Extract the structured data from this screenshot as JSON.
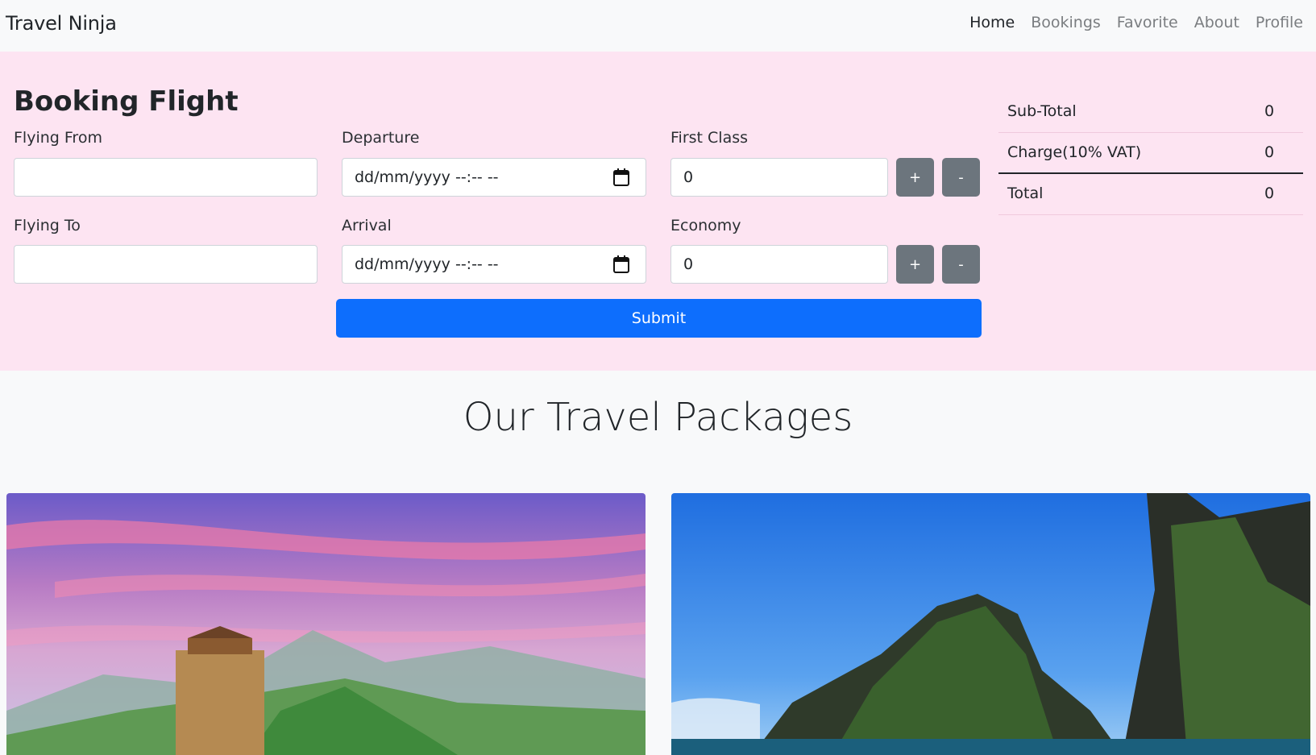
{
  "navbar": {
    "brand": "Travel Ninja",
    "links": [
      "Home",
      "Bookings",
      "Favorite",
      "About",
      "Profile"
    ],
    "active": "Home"
  },
  "booking": {
    "title": "Booking Flight",
    "flying_from_label": "Flying From",
    "flying_from_value": "",
    "flying_to_label": "Flying To",
    "flying_to_value": "",
    "departure_label": "Departure",
    "departure_placeholder": "dd/mm/yyyy --:-- --",
    "arrival_label": "Arrival",
    "arrival_placeholder": "dd/mm/yyyy --:-- --",
    "first_class_label": "First Class",
    "first_class_value": "0",
    "economy_label": "Economy",
    "economy_value": "0",
    "plus_label": "+",
    "minus_label": "-",
    "submit_label": "Submit"
  },
  "summary": {
    "subtotal_label": "Sub-Total",
    "subtotal_value": "0",
    "charge_label": "Charge(10% VAT)",
    "charge_value": "0",
    "total_label": "Total",
    "total_value": "0"
  },
  "packages": {
    "title": "Our Travel Packages"
  },
  "colors": {
    "booking_bg": "#fde4f2",
    "primary": "#0d6efd",
    "secondary": "#6c757d"
  }
}
